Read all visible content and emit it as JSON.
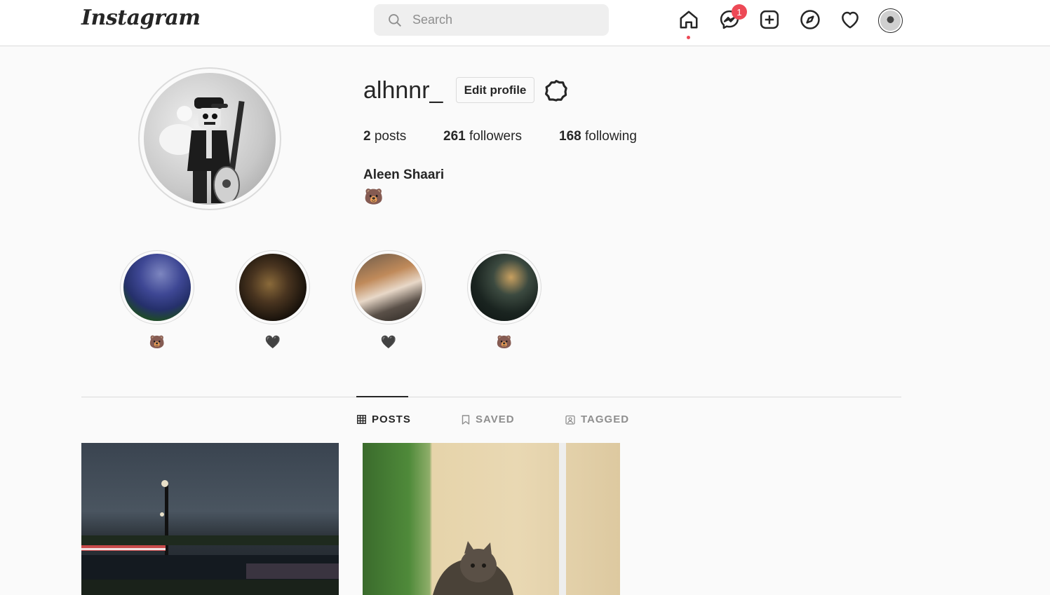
{
  "nav": {
    "logo": "Instagram",
    "search_placeholder": "Search",
    "messages_badge": "1",
    "colors": {
      "badge": "#ed4956",
      "border": "#dbdbdb",
      "text": "#262626",
      "muted": "#8e8e8e"
    }
  },
  "profile": {
    "username": "alhnnr_",
    "edit_label": "Edit profile",
    "stats": {
      "posts_count": "2",
      "posts_label": "posts",
      "followers_count": "261",
      "followers_label": "followers",
      "following_count": "168",
      "following_label": "following"
    },
    "full_name": "Aleen Shaari",
    "bio": "🐻"
  },
  "highlights": [
    {
      "label": "🐻"
    },
    {
      "label": "🖤"
    },
    {
      "label": "🖤"
    },
    {
      "label": "🐻"
    }
  ],
  "tabs": [
    {
      "label": "POSTS",
      "icon": "grid-icon",
      "active": true
    },
    {
      "label": "SAVED",
      "icon": "bookmark-icon",
      "active": false
    },
    {
      "label": "TAGGED",
      "icon": "tagged-icon",
      "active": false
    }
  ]
}
